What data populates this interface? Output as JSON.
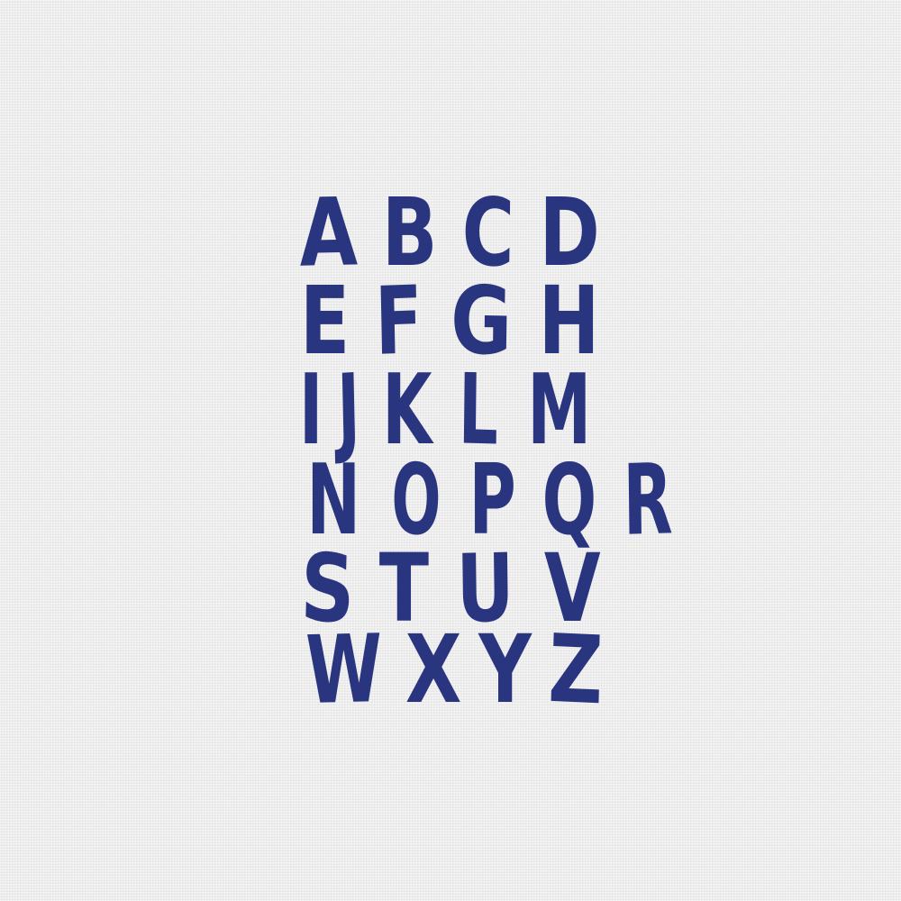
{
  "theme": {
    "background_color": "#ededed",
    "letter_color": "#2a3580"
  },
  "alphabet": {
    "rows": [
      [
        "A",
        "B",
        "C",
        "D"
      ],
      [
        "E",
        "F",
        "G",
        "H"
      ],
      [
        "I",
        "J",
        "K",
        "L",
        "M"
      ],
      [
        "N",
        "O",
        "P",
        "Q",
        "R"
      ],
      [
        "S",
        "T",
        "U",
        "V"
      ],
      [
        "W",
        "X",
        "Y",
        "Z"
      ]
    ]
  }
}
